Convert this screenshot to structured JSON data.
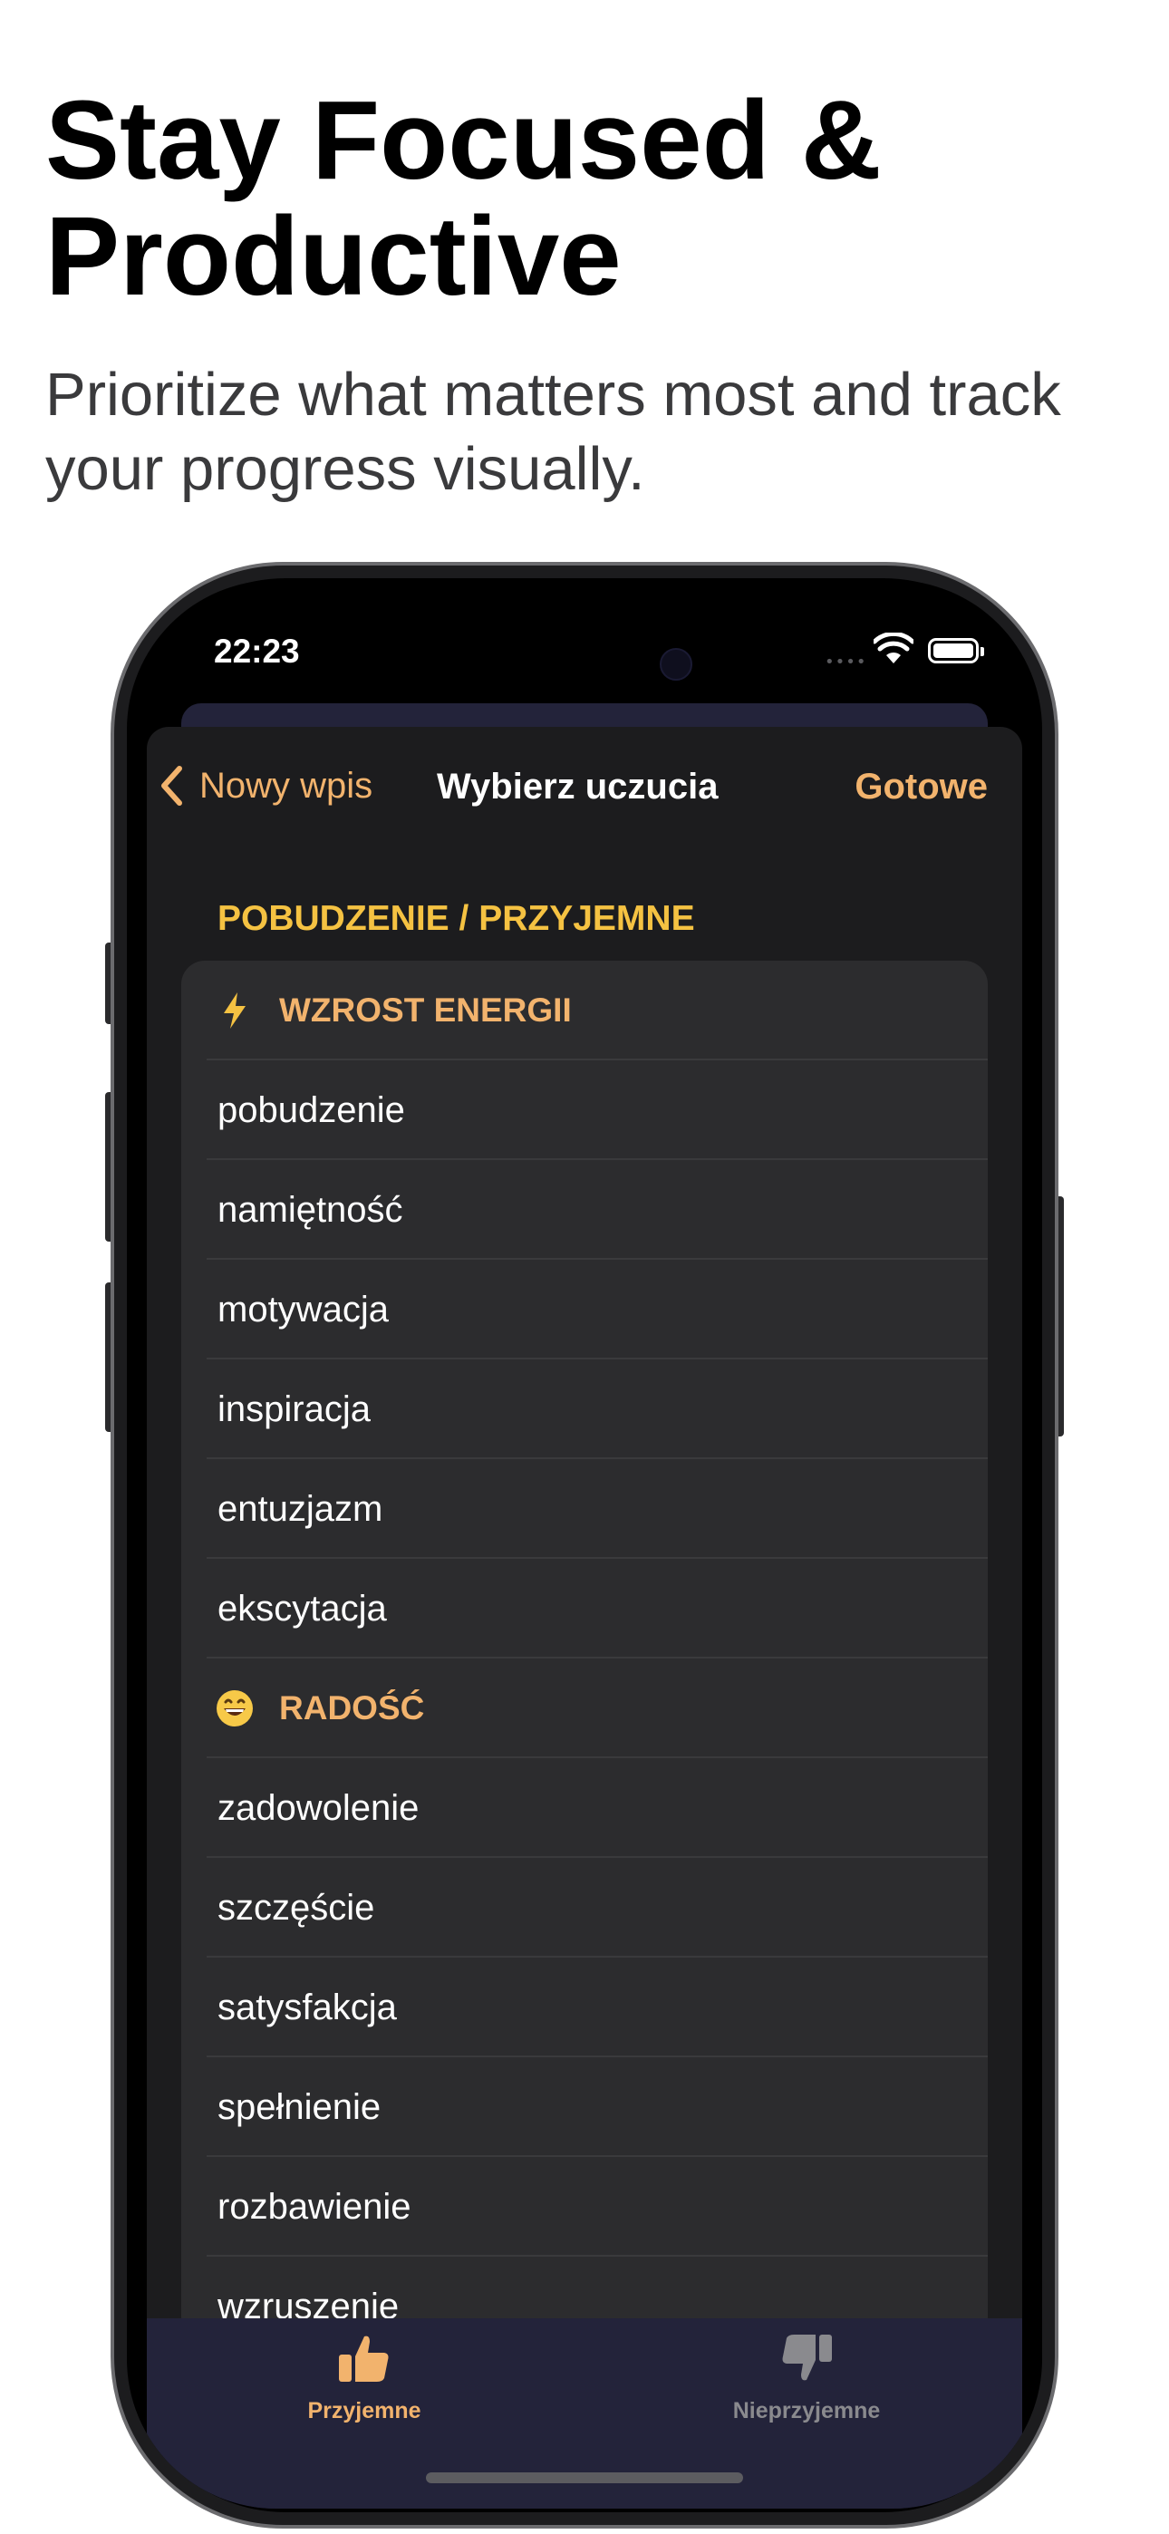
{
  "promo": {
    "headline": "Stay Focused & Productive",
    "subline": "Prioritize what matters most and track your progress visually."
  },
  "status_bar": {
    "time": "22:23",
    "signal_dots": "••••"
  },
  "nav": {
    "back_label": "Nowy wpis",
    "title": "Wybierz uczucia",
    "done_label": "Gotowe"
  },
  "section": {
    "header": "POBUDZENIE / PRZYJEMNE"
  },
  "groups": [
    {
      "icon": "lightning-icon",
      "emoji": "⚡",
      "label": "WZROST ENERGII",
      "items": [
        "pobudzenie",
        "namiętność",
        "motywacja",
        "inspiracja",
        "entuzjazm",
        "ekscytacja"
      ]
    },
    {
      "icon": "grinning-face-icon",
      "emoji": "😄",
      "label": "RADOŚĆ",
      "items": [
        "zadowolenie",
        "szczęście",
        "satysfakcja",
        "spełnienie",
        "rozbawienie",
        "wzruszenie"
      ]
    }
  ],
  "tabs": [
    {
      "label": "Przyjemne",
      "icon": "thumbs-up-icon",
      "active": true
    },
    {
      "label": "Nieprzyjemne",
      "icon": "thumbs-down-icon",
      "active": false
    }
  ],
  "colors": {
    "accent": "#f2b36d",
    "section_header": "#f5c242",
    "sheet_bg": "#1c1c1e",
    "list_bg": "#2c2c2e",
    "tabbar_bg": "#23233a"
  }
}
